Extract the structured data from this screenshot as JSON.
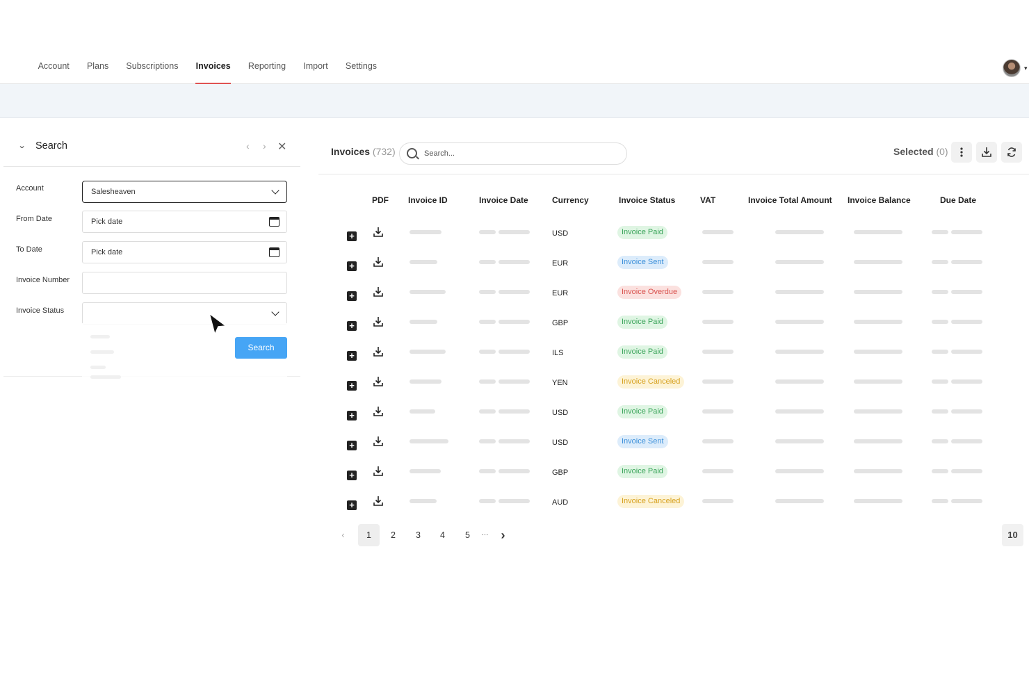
{
  "nav": {
    "tabs": [
      {
        "label": "Account"
      },
      {
        "label": "Plans"
      },
      {
        "label": "Subscriptions"
      },
      {
        "label": "Invoices"
      },
      {
        "label": "Reporting"
      },
      {
        "label": "Import"
      },
      {
        "label": "Settings"
      }
    ],
    "active_tab": "Invoices"
  },
  "search_panel": {
    "title": "Search",
    "fields": {
      "account": {
        "label": "Account",
        "value": "Salesheaven"
      },
      "from_date": {
        "label": "From Date",
        "placeholder": "Pick date"
      },
      "to_date": {
        "label": "To Date",
        "placeholder": "Pick date"
      },
      "invoice_number": {
        "label": "Invoice Number",
        "value": ""
      },
      "invoice_status": {
        "label": "Invoice Status",
        "value": ""
      }
    },
    "search_button": "Search"
  },
  "invoices": {
    "title": "Invoices",
    "count": "(732)",
    "search_placeholder": "Search...",
    "selected_label": "Selected",
    "selected_count": "(0)",
    "columns": [
      "PDF",
      "Invoice ID",
      "Invoice Date",
      "Currency",
      "Invoice Status",
      "VAT",
      "Invoice Total Amount",
      "Invoice Balance",
      "Due Date"
    ],
    "rows": [
      {
        "currency": "USD",
        "status": "Invoice Paid",
        "status_kind": "paid"
      },
      {
        "currency": "EUR",
        "status": "Invoice Sent",
        "status_kind": "sent"
      },
      {
        "currency": "EUR",
        "status": "Invoice Overdue",
        "status_kind": "overdue"
      },
      {
        "currency": "GBP",
        "status": "Invoice Paid",
        "status_kind": "paid"
      },
      {
        "currency": "ILS",
        "status": "Invoice Paid",
        "status_kind": "paid"
      },
      {
        "currency": "YEN",
        "status": "Invoice Canceled",
        "status_kind": "canceled"
      },
      {
        "currency": "USD",
        "status": "Invoice Paid",
        "status_kind": "paid"
      },
      {
        "currency": "USD",
        "status": "Invoice Sent",
        "status_kind": "sent"
      },
      {
        "currency": "GBP",
        "status": "Invoice Paid",
        "status_kind": "paid"
      },
      {
        "currency": "AUD",
        "status": "Invoice Canceled",
        "status_kind": "canceled"
      }
    ],
    "status_colors": {
      "paid": {
        "bg": "#dff5e3",
        "fg": "#3aa45a"
      },
      "sent": {
        "bg": "#dcecfb",
        "fg": "#3b8fd9"
      },
      "overdue": {
        "bg": "#fbe1df",
        "fg": "#d9534f"
      },
      "canceled": {
        "bg": "#fdf3d6",
        "fg": "#d6a01d"
      }
    }
  },
  "pagination": {
    "pages": [
      "1",
      "2",
      "3",
      "4",
      "5"
    ],
    "current": "1",
    "ellipsis": "···",
    "per_page": "10"
  },
  "colors": {
    "accent": "#e05252",
    "primary_button": "#46a5f5",
    "banner": "#f1f5f9"
  }
}
